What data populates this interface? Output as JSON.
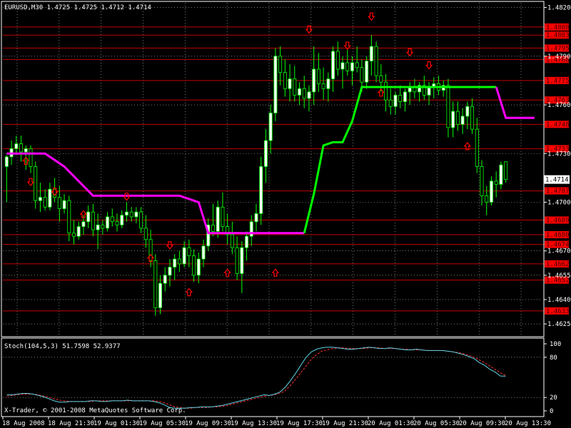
{
  "header": {
    "symbol_info": "EURUSD,M30  1.4725 1.4725 1.4712 1.4714"
  },
  "indicator": {
    "title": "Stoch(104,5,3) 51.7598 52.9377",
    "scale_labels": [
      "100",
      "80",
      "20",
      "0"
    ]
  },
  "watermark": "X-Trader, © 2001-2008 MetaQuotes Software Corp.",
  "colors": {
    "background": "#000000",
    "grid": "#c0c0c0",
    "level_line": "#c00000",
    "level_label_bg": "#ff0000",
    "bull_body": "#ffffff",
    "bear_body": "#000000",
    "wick": "#00ff00",
    "trend_up": "#00ff00",
    "trend_down": "#ff00ff",
    "arrow": "#ff0000",
    "stoch_main": "#5fd3e6",
    "stoch_signal": "#ff3030",
    "current_price_bg": "#ffffff"
  },
  "chart_data": [
    {
      "type": "candlestick",
      "price_axis": {
        "ticks": [
          "1.4820",
          "1.4790",
          "1.4760",
          "1.4730",
          "1.4700",
          "1.4670",
          "1.4655",
          "1.4640",
          "1.4625"
        ],
        "ylim": [
          1.4618,
          1.4822
        ]
      },
      "time_axis": {
        "labels": [
          "18 Aug 2008",
          "18 Aug 21:30",
          "19 Aug 01:30",
          "19 Aug 05:30",
          "19 Aug 09:30",
          "19 Aug 13:30",
          "19 Aug 17:30",
          "19 Aug 21:30",
          "20 Aug 01:30",
          "20 Aug 05:30",
          "20 Aug 09:30",
          "20 Aug 13:30"
        ]
      },
      "current_price": "1.4714",
      "levels": [
        "1.4808",
        "1.4803",
        "1.4795",
        "1.4788",
        "1.4775",
        "1.4763",
        "1.4748",
        "1.4733",
        "1.4707",
        "1.4689",
        "1.4680",
        "1.4674",
        "1.4662",
        "1.4652",
        "1.4633"
      ],
      "candles": [
        [
          1.4722,
          1.4729,
          1.47,
          1.4728
        ],
        [
          1.4728,
          1.4738,
          1.4723,
          1.4733
        ],
        [
          1.4733,
          1.4741,
          1.4729,
          1.4736
        ],
        [
          1.4736,
          1.4741,
          1.4725,
          1.4731
        ],
        [
          1.4731,
          1.4735,
          1.472,
          1.4733
        ],
        [
          1.4733,
          1.4735,
          1.4718,
          1.4722
        ],
        [
          1.4722,
          1.4725,
          1.4696,
          1.4701
        ],
        [
          1.4701,
          1.4712,
          1.4694,
          1.4703
        ],
        [
          1.4703,
          1.4708,
          1.4695,
          1.4697
        ],
        [
          1.4697,
          1.4712,
          1.4695,
          1.4708
        ],
        [
          1.4708,
          1.4715,
          1.47,
          1.4703
        ],
        [
          1.4703,
          1.471,
          1.4688,
          1.4696
        ],
        [
          1.4696,
          1.4705,
          1.4693,
          1.4701
        ],
        [
          1.4701,
          1.4704,
          1.4676,
          1.4681
        ],
        [
          1.4681,
          1.4689,
          1.4674,
          1.4679
        ],
        [
          1.4679,
          1.4688,
          1.4677,
          1.4685
        ],
        [
          1.4685,
          1.4692,
          1.468,
          1.4688
        ],
        [
          1.4688,
          1.4698,
          1.4684,
          1.4694
        ],
        [
          1.4694,
          1.4699,
          1.4679,
          1.4683
        ],
        [
          1.4683,
          1.4693,
          1.4671,
          1.4686
        ],
        [
          1.4686,
          1.4689,
          1.468,
          1.4684
        ],
        [
          1.4684,
          1.4694,
          1.4682,
          1.4691
        ],
        [
          1.4691,
          1.4696,
          1.4685,
          1.4688
        ],
        [
          1.4688,
          1.4693,
          1.4682,
          1.4686
        ],
        [
          1.4686,
          1.4695,
          1.4684,
          1.4692
        ],
        [
          1.4692,
          1.47,
          1.4688,
          1.4694
        ],
        [
          1.4694,
          1.4697,
          1.4688,
          1.4691
        ],
        [
          1.4691,
          1.4697,
          1.4687,
          1.4694
        ],
        [
          1.4694,
          1.4697,
          1.4681,
          1.4684
        ],
        [
          1.4684,
          1.4692,
          1.4672,
          1.4677
        ],
        [
          1.4677,
          1.4683,
          1.466,
          1.4664
        ],
        [
          1.4664,
          1.4668,
          1.463,
          1.4635
        ],
        [
          1.4635,
          1.4655,
          1.4631,
          1.465
        ],
        [
          1.465,
          1.466,
          1.4645,
          1.4655
        ],
        [
          1.4655,
          1.4665,
          1.4648,
          1.466
        ],
        [
          1.466,
          1.4668,
          1.4652,
          1.4665
        ],
        [
          1.4665,
          1.467,
          1.4657,
          1.4662
        ],
        [
          1.4662,
          1.4676,
          1.466,
          1.4672
        ],
        [
          1.4672,
          1.4677,
          1.466,
          1.4667
        ],
        [
          1.4667,
          1.4671,
          1.4651,
          1.4655
        ],
        [
          1.4655,
          1.4669,
          1.465,
          1.4665
        ],
        [
          1.4665,
          1.4677,
          1.466,
          1.4673
        ],
        [
          1.4673,
          1.469,
          1.467,
          1.4686
        ],
        [
          1.4686,
          1.4699,
          1.4679,
          1.4682
        ],
        [
          1.4682,
          1.4701,
          1.4678,
          1.4697
        ],
        [
          1.4697,
          1.4706,
          1.4682,
          1.4685
        ],
        [
          1.4685,
          1.4693,
          1.4674,
          1.468
        ],
        [
          1.468,
          1.4688,
          1.4668,
          1.4672
        ],
        [
          1.4672,
          1.4679,
          1.4652,
          1.4656
        ],
        [
          1.4656,
          1.4676,
          1.4644,
          1.4672
        ],
        [
          1.4672,
          1.4682,
          1.4664,
          1.4679
        ],
        [
          1.4679,
          1.4692,
          1.4673,
          1.4688
        ],
        [
          1.4688,
          1.4699,
          1.4682,
          1.4693
        ],
        [
          1.4693,
          1.4728,
          1.4686,
          1.4722
        ],
        [
          1.4722,
          1.4745,
          1.4712,
          1.4738
        ],
        [
          1.4738,
          1.476,
          1.473,
          1.4755
        ],
        [
          1.4755,
          1.4795,
          1.475,
          1.479
        ],
        [
          1.479,
          1.4796,
          1.4772,
          1.478
        ],
        [
          1.478,
          1.4788,
          1.4765,
          1.477
        ],
        [
          1.477,
          1.4785,
          1.4762,
          1.4776
        ],
        [
          1.4776,
          1.4784,
          1.4762,
          1.4766
        ],
        [
          1.4766,
          1.4774,
          1.476,
          1.477
        ],
        [
          1.477,
          1.4778,
          1.4758,
          1.4764
        ],
        [
          1.4764,
          1.4772,
          1.4756,
          1.4768
        ],
        [
          1.4768,
          1.4796,
          1.476,
          1.4782
        ],
        [
          1.4782,
          1.4792,
          1.4768,
          1.4773
        ],
        [
          1.4773,
          1.4783,
          1.4763,
          1.477
        ],
        [
          1.477,
          1.478,
          1.4762,
          1.4776
        ],
        [
          1.4776,
          1.4796,
          1.4768,
          1.4793
        ],
        [
          1.4793,
          1.4799,
          1.4778,
          1.4782
        ],
        [
          1.4782,
          1.479,
          1.477,
          1.4786
        ],
        [
          1.4786,
          1.4794,
          1.4778,
          1.4781
        ],
        [
          1.4781,
          1.479,
          1.4772,
          1.4786
        ],
        [
          1.4786,
          1.4796,
          1.478,
          1.4783
        ],
        [
          1.4783,
          1.4788,
          1.4768,
          1.4774
        ],
        [
          1.4774,
          1.479,
          1.477,
          1.4787
        ],
        [
          1.4787,
          1.4803,
          1.4778,
          1.4796
        ],
        [
          1.4796,
          1.4799,
          1.4774,
          1.4778
        ],
        [
          1.4778,
          1.4785,
          1.4768,
          1.4774
        ],
        [
          1.4774,
          1.4779,
          1.4756,
          1.4763
        ],
        [
          1.4763,
          1.477,
          1.4754,
          1.4759
        ],
        [
          1.4759,
          1.4768,
          1.4754,
          1.4766
        ],
        [
          1.4766,
          1.4772,
          1.4758,
          1.4762
        ],
        [
          1.4762,
          1.477,
          1.4756,
          1.4768
        ],
        [
          1.4768,
          1.4774,
          1.476,
          1.4771
        ],
        [
          1.4771,
          1.4776,
          1.4764,
          1.4768
        ],
        [
          1.4768,
          1.4774,
          1.4762,
          1.4772
        ],
        [
          1.4772,
          1.4778,
          1.4763,
          1.4766
        ],
        [
          1.4766,
          1.4774,
          1.476,
          1.4771
        ],
        [
          1.4771,
          1.4777,
          1.4764,
          1.4773
        ],
        [
          1.4773,
          1.4778,
          1.4766,
          1.4769
        ],
        [
          1.4769,
          1.4775,
          1.4765,
          1.4772
        ],
        [
          1.4772,
          1.4776,
          1.474,
          1.4746
        ],
        [
          1.4746,
          1.4762,
          1.474,
          1.4756
        ],
        [
          1.4756,
          1.4762,
          1.4744,
          1.4748
        ],
        [
          1.4748,
          1.4758,
          1.4742,
          1.4753
        ],
        [
          1.4753,
          1.4762,
          1.4745,
          1.4759
        ],
        [
          1.4759,
          1.4764,
          1.4742,
          1.4745
        ],
        [
          1.4745,
          1.4752,
          1.4718,
          1.4722
        ],
        [
          1.4722,
          1.4726,
          1.4698,
          1.4704
        ],
        [
          1.4704,
          1.471,
          1.4692,
          1.47
        ],
        [
          1.47,
          1.4716,
          1.4698,
          1.4713
        ],
        [
          1.4713,
          1.4719,
          1.4703,
          1.4711
        ],
        [
          1.4711,
          1.4725,
          1.4708,
          1.4723
        ],
        [
          1.4725,
          1.4725,
          1.4712,
          1.4714
        ]
      ],
      "trend_line": {
        "down": [
          [
            0,
            1.473
          ],
          [
            8,
            1.473
          ],
          [
            12,
            1.4722
          ],
          [
            18,
            1.4704
          ],
          [
            36,
            1.4704
          ],
          [
            40,
            1.47
          ],
          [
            42,
            1.4681
          ],
          [
            60,
            1.4681
          ],
          [
            62,
            1.4681
          ]
        ],
        "up": [
          [
            62,
            1.4681
          ],
          [
            64,
            1.4705
          ],
          [
            66,
            1.4735
          ],
          [
            68,
            1.4737
          ],
          [
            70,
            1.4737
          ],
          [
            72,
            1.475
          ],
          [
            74,
            1.4771
          ],
          [
            90,
            1.4771
          ],
          [
            102,
            1.4771
          ]
        ],
        "down_tail": [
          [
            102,
            1.4771
          ],
          [
            104,
            1.4752
          ],
          [
            110,
            1.4752
          ]
        ]
      },
      "arrows_down": [
        [
          5,
          1.4712
        ],
        [
          10,
          1.4706
        ],
        [
          25,
          1.4703
        ],
        [
          34,
          1.4673
        ],
        [
          63,
          1.4806
        ],
        [
          71,
          1.4796
        ],
        [
          76,
          1.4814
        ],
        [
          84,
          1.4792
        ],
        [
          88,
          1.4784
        ]
      ],
      "arrows_up": [
        [
          4,
          1.4726
        ],
        [
          16,
          1.4693
        ],
        [
          30,
          1.4666
        ],
        [
          38,
          1.4645
        ],
        [
          46,
          1.4657
        ],
        [
          56,
          1.4657
        ],
        [
          78,
          1.4768
        ],
        [
          96,
          1.4735
        ]
      ]
    },
    {
      "type": "line",
      "name": "Stoch(104,5,3)",
      "ylim": [
        0,
        100
      ],
      "levels": [
        20,
        80
      ],
      "series": [
        {
          "name": "main",
          "values": [
            24,
            24,
            25,
            26,
            26,
            25,
            23,
            21,
            18,
            15,
            13,
            13,
            14,
            14,
            14,
            14,
            15,
            15,
            14,
            14,
            15,
            15,
            15,
            16,
            15,
            15,
            15,
            15,
            14,
            12,
            9,
            5,
            4,
            4,
            4,
            5,
            5,
            6,
            6,
            6,
            7,
            8,
            10,
            12,
            14,
            16,
            18,
            20,
            22,
            24,
            23,
            25,
            28,
            35,
            45,
            56,
            68,
            80,
            88,
            92,
            94,
            95,
            95,
            94,
            93,
            92,
            92,
            93,
            94,
            95,
            94,
            93,
            93,
            94,
            93,
            92,
            91,
            91,
            92,
            91,
            90,
            90,
            90,
            90,
            89,
            88,
            86,
            84,
            81,
            78,
            72,
            68,
            62,
            58,
            52,
            51.7598
          ]
        },
        {
          "name": "signal",
          "values": [
            22,
            23,
            24,
            25,
            25,
            25,
            24,
            22,
            20,
            18,
            16,
            15,
            14,
            14,
            14,
            14,
            14,
            15,
            15,
            15,
            15,
            15,
            15,
            15,
            15,
            15,
            15,
            15,
            15,
            14,
            12,
            9,
            6,
            5,
            4,
            4,
            5,
            5,
            5,
            6,
            6,
            7,
            8,
            10,
            12,
            14,
            16,
            18,
            20,
            22,
            23,
            24,
            26,
            30,
            38,
            47,
            57,
            67,
            77,
            84,
            89,
            91,
            93,
            94,
            94,
            93,
            93,
            93,
            93,
            94,
            94,
            94,
            93,
            93,
            93,
            92,
            92,
            91,
            91,
            91,
            90,
            90,
            90,
            90,
            89,
            88,
            87,
            85,
            83,
            80,
            76,
            72,
            67,
            62,
            57,
            52.9377
          ]
        }
      ]
    }
  ]
}
